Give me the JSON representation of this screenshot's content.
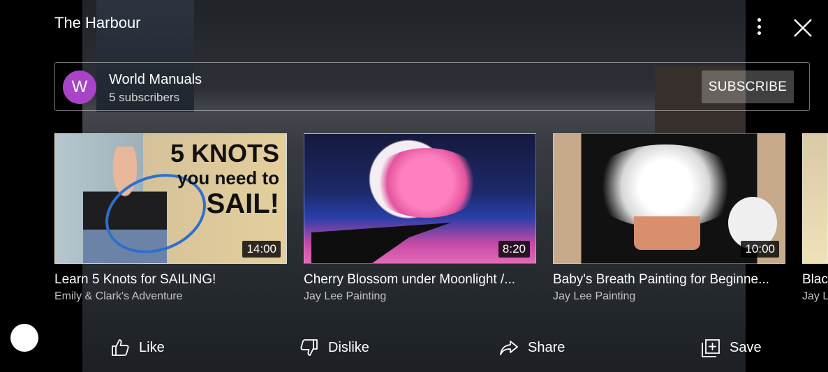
{
  "header": {
    "title": "The Harbour"
  },
  "channel": {
    "avatar_letter": "W",
    "name": "World Manuals",
    "subscribers": "5 subscribers",
    "subscribe_label": "SUBSCRIBE",
    "avatar_color": "#a943c7"
  },
  "videos": [
    {
      "title": "Learn 5 Knots for SAILING!",
      "channel": "Emily & Clark's Adventure",
      "duration": "14:00",
      "thumb_text": [
        "5 KNOTS",
        "you need to",
        "SAIL!"
      ]
    },
    {
      "title": "Cherry Blossom under Moonlight /...",
      "channel": "Jay Lee Painting",
      "duration": "8:20"
    },
    {
      "title": "Baby's Breath Painting for Beginne...",
      "channel": "Jay Lee Painting",
      "duration": "10:00"
    },
    {
      "title": "Blac",
      "channel": "Jay L"
    }
  ],
  "actions": {
    "like": "Like",
    "dislike": "Dislike",
    "share": "Share",
    "save": "Save"
  }
}
